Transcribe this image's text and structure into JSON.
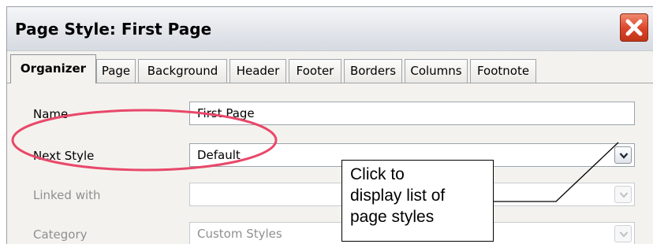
{
  "window": {
    "title": "Page Style: First Page",
    "close_icon": "close-icon"
  },
  "tabs": [
    {
      "label": "Organizer",
      "active": true
    },
    {
      "label": "Page",
      "active": false
    },
    {
      "label": "Background",
      "active": false
    },
    {
      "label": "Header",
      "active": false
    },
    {
      "label": "Footer",
      "active": false
    },
    {
      "label": "Borders",
      "active": false
    },
    {
      "label": "Columns",
      "active": false
    },
    {
      "label": "Footnote",
      "active": false
    }
  ],
  "form": {
    "name": {
      "label": "Name",
      "value": "First Page"
    },
    "next_style": {
      "label": "Next Style",
      "value": "Default",
      "dropdown_icon": "chevron-down-icon"
    },
    "linked_with": {
      "label": "Linked with",
      "value": "",
      "enabled": false
    },
    "category": {
      "label": "Category",
      "value": "Custom Styles",
      "enabled": false
    }
  },
  "annotation": {
    "callout_lines": [
      "Click to",
      "display list of",
      "page styles"
    ],
    "ellipse_color": "#e8486a"
  },
  "colors": {
    "close_button": "#d9452a",
    "title_bar": "#e3e6eb",
    "panel": "#f4f2ee"
  }
}
